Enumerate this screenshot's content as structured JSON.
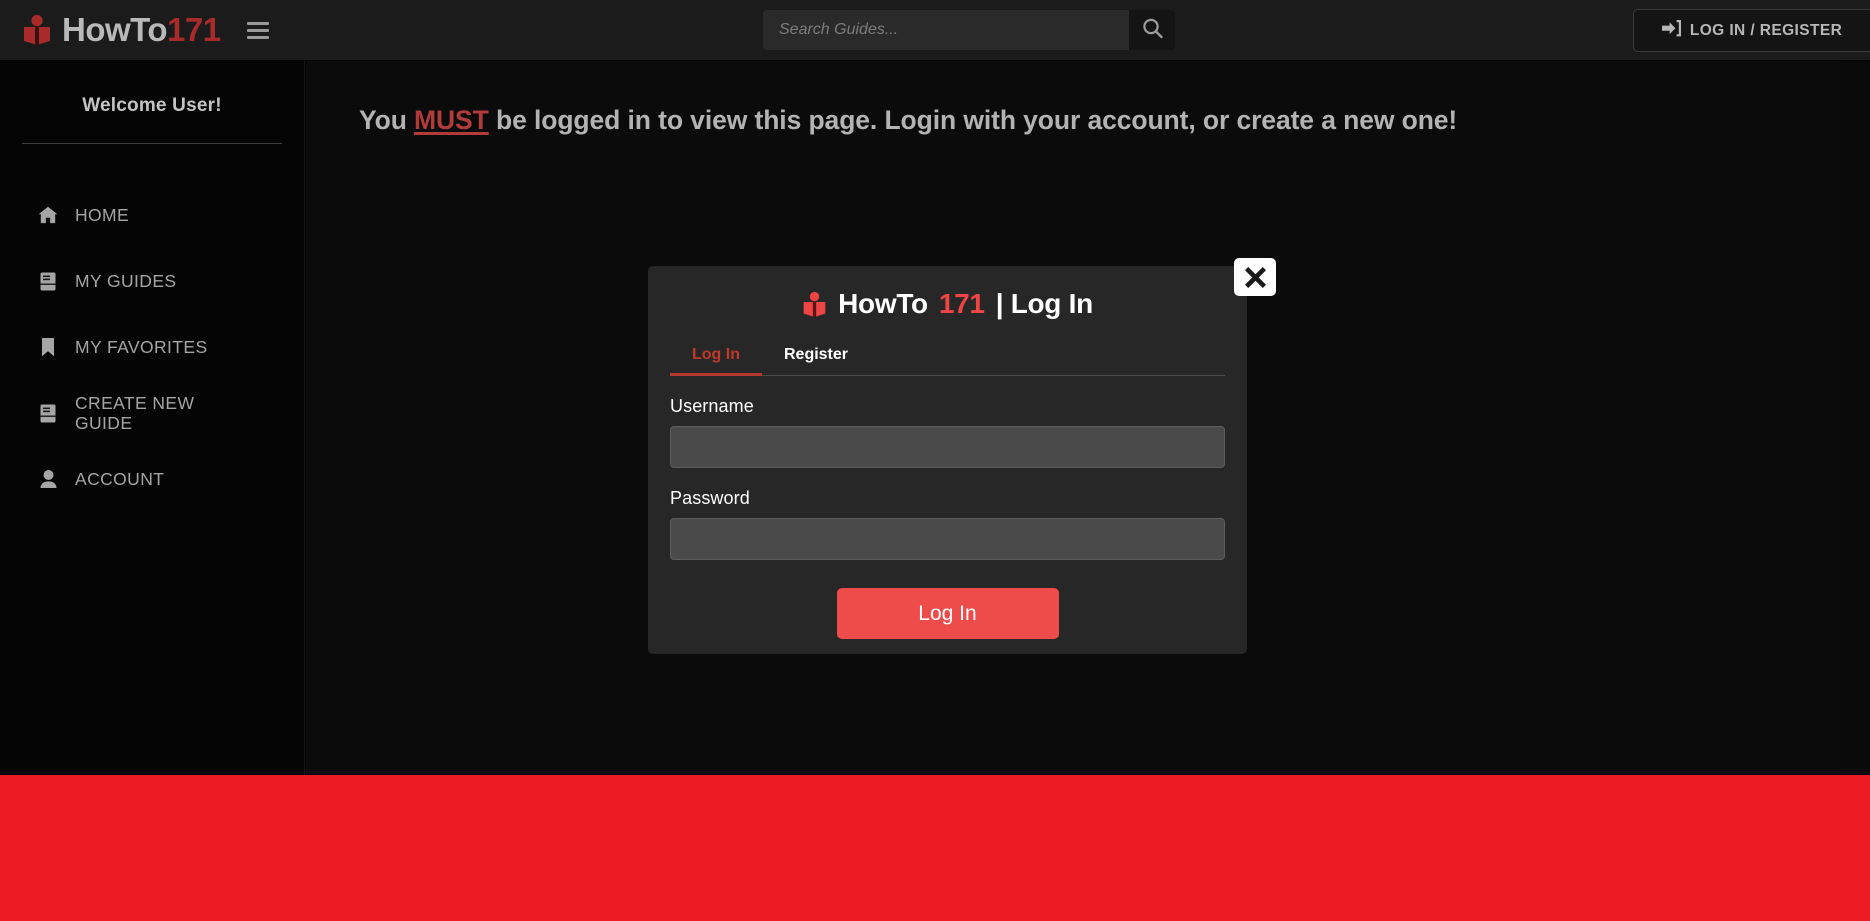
{
  "brand": {
    "name": "HowTo",
    "number": "171",
    "logo_icon": "book-reader-icon"
  },
  "topbar": {
    "menu_icon": "hamburger-menu-icon",
    "search": {
      "placeholder": "Search Guides...",
      "value": "",
      "icon": "search-icon"
    },
    "login_button": {
      "label": "LOG IN / REGISTER",
      "icon": "sign-in-icon"
    }
  },
  "sidebar": {
    "welcome": "Welcome User!",
    "items": [
      {
        "label": "HOME",
        "icon": "home-icon"
      },
      {
        "label": "MY GUIDES",
        "icon": "book-icon"
      },
      {
        "label": "MY FAVORITES",
        "icon": "bookmark-icon"
      },
      {
        "label": "CREATE NEW GUIDE",
        "icon": "book-icon"
      },
      {
        "label": "ACCOUNT",
        "icon": "user-icon"
      }
    ]
  },
  "main": {
    "headline_prefix": "You ",
    "headline_emphasis": "MUST",
    "headline_suffix": " be logged in to view this page. Login with your account, or create a new one!"
  },
  "modal": {
    "title_brand": "HowTo",
    "title_number": "171",
    "title_suffix": "| Log In",
    "logo_icon": "book-reader-icon",
    "close_icon": "close-x-icon",
    "tabs": [
      {
        "label": "Log In",
        "active": true
      },
      {
        "label": "Register",
        "active": false
      }
    ],
    "fields": [
      {
        "label": "Username",
        "value": "",
        "placeholder": "",
        "type": "text"
      },
      {
        "label": "Password",
        "value": "",
        "placeholder": "",
        "type": "password"
      }
    ],
    "submit_label": "Log In"
  },
  "colors": {
    "brand_red": "#a82a2a",
    "accent_red": "#ef4444",
    "footer_red": "#ed1c24",
    "tab_active": "#c0392b",
    "must_red": "#b13a3a",
    "topbar_bg": "#1b1b1b",
    "sidebar_bg": "#050505",
    "modal_bg": "#272727",
    "input_bg": "#4a4a4a"
  }
}
